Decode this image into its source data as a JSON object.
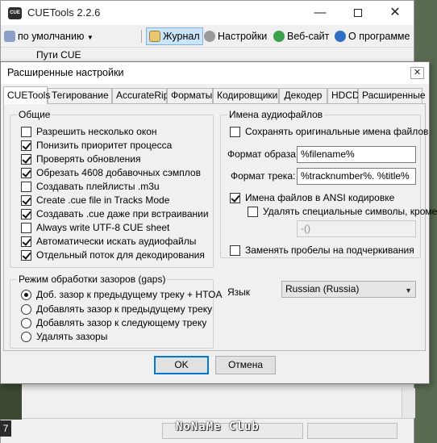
{
  "app": {
    "title": "CUETools 2.2.6",
    "icon_text": "CUE",
    "window_controls": {
      "minimize": "—",
      "close": "✕"
    },
    "toolbar": {
      "profile": "по умолчанию",
      "journal": "Журнал",
      "settings": "Настройки",
      "website": "Веб-сайт",
      "about": "О программе"
    },
    "panel_label": "Пути CUE",
    "left_number": "7",
    "watermark": "NoNaMe Club"
  },
  "dialog": {
    "title": "Расширенные настройки",
    "close_glyph": "✕",
    "tabs": [
      "CUETools",
      "Тегирование",
      "AccurateRip",
      "Форматы",
      "Кодировщики",
      "Декодер",
      "HDCD",
      "Расширенные"
    ],
    "active_tab": 0,
    "general": {
      "title": "Общие",
      "options": [
        {
          "label": "Разрешить несколько окон",
          "checked": false
        },
        {
          "label": "Понизить приоритет процесса",
          "checked": true
        },
        {
          "label": "Проверять обновления",
          "checked": true
        },
        {
          "label": "Обрезать 4608 добавочных сэмплов",
          "checked": true
        },
        {
          "label": "Создавать плейлисты .m3u",
          "checked": false
        },
        {
          "label": "Create .cue file in Tracks Mode",
          "checked": true
        },
        {
          "label": "Создавать .cue даже при встраивании",
          "checked": true
        },
        {
          "label": "Always write UTF-8 CUE sheet",
          "checked": false
        },
        {
          "label": "Автоматически искать аудиофайлы",
          "checked": true
        },
        {
          "label": "Отдельный поток для декодирования",
          "checked": true
        }
      ]
    },
    "gaps": {
      "title": "Режим обработки зазоров (gaps)",
      "options": [
        {
          "label": "Доб. зазор к предыдущему треку + HTOA",
          "selected": true
        },
        {
          "label": "Добавлять зазор к предыдущему треку",
          "selected": false
        },
        {
          "label": "Добавлять зазор к следующему треку",
          "selected": false
        },
        {
          "label": "Удалять зазоры",
          "selected": false
        }
      ]
    },
    "filenames": {
      "title": "Имена аудиофайлов",
      "keep_original": {
        "label": "Сохранять оригинальные имена файлов",
        "checked": false
      },
      "image_format_label": "Формат образа:",
      "image_format_value": "%filename%",
      "track_format_label": "Формат трека:",
      "track_format_value": "%tracknumber%. %title%",
      "ansi": {
        "label": "Имена файлов в ANSI кодировке",
        "checked": true
      },
      "remove_special": {
        "label": "Удалять специальные символы, кроме:",
        "checked": false
      },
      "special_value": "-()",
      "replace_spaces": {
        "label": "Заменять пробелы на подчеркивания",
        "checked": false
      }
    },
    "language": {
      "label": "Язык",
      "value": "Russian (Russia)"
    },
    "buttons": {
      "ok": "OK",
      "cancel": "Отмена"
    }
  },
  "colors": {
    "accent": "#0078d7",
    "tab_active": "#ffffff",
    "journal_highlight": "#cce4f7"
  }
}
